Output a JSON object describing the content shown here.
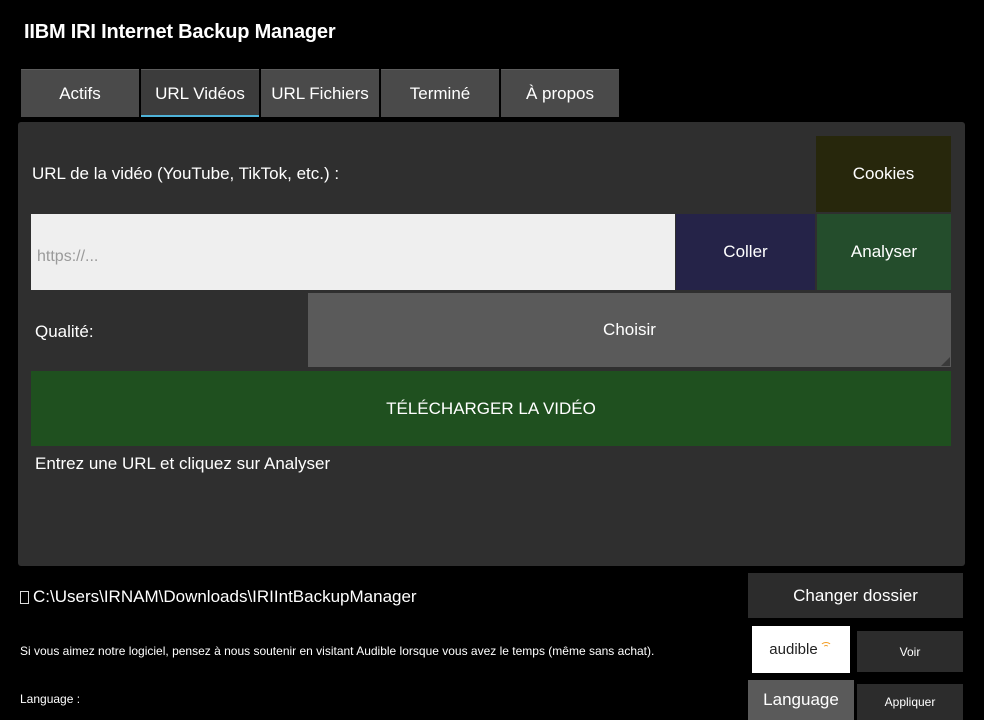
{
  "app": {
    "title": "IIBM IRI Internet Backup Manager"
  },
  "tabs": [
    {
      "label": "Actifs",
      "active": false
    },
    {
      "label": "URL Vidéos",
      "active": true
    },
    {
      "label": "URL Fichiers",
      "active": false
    },
    {
      "label": "Terminé",
      "active": false
    },
    {
      "label": "À propos",
      "active": false
    }
  ],
  "video_panel": {
    "url_label": "URL de la vidéo (YouTube, TikTok, etc.) :",
    "cookies_label": "Cookies",
    "url_input": {
      "value": "",
      "placeholder": "https://..."
    },
    "paste_label": "Coller",
    "analyze_label": "Analyser",
    "quality_label": "Qualité:",
    "quality_select_label": "Choisir",
    "download_label": "TÉLÉCHARGER LA VIDÉO",
    "status": "Entrez une URL et cliquez sur Analyser"
  },
  "footer": {
    "folder_icon": "folder-icon",
    "folder_path": "C:\\Users\\IRNAM\\Downloads\\IRIIntBackupManager",
    "change_folder_label": "Changer dossier",
    "support_text": "Si vous aimez notre logiciel, pensez à nous soutenir en visitant Audible lorsque vous avez le temps (même sans achat).",
    "audible_logo_text": "audible",
    "view_label": "Voir",
    "language_label": "Language :",
    "language_button_label": "Language",
    "apply_label": "Appliquer"
  },
  "colors": {
    "background": "#000000",
    "panel": "#2f2f2f",
    "tab_active_underline": "#4fb3d9",
    "paste_button": "#252348",
    "analyze_button": "#244d2c",
    "cookies_button": "#27270c",
    "download_button": "#1f501f",
    "audible_orange": "#f29a1e"
  }
}
